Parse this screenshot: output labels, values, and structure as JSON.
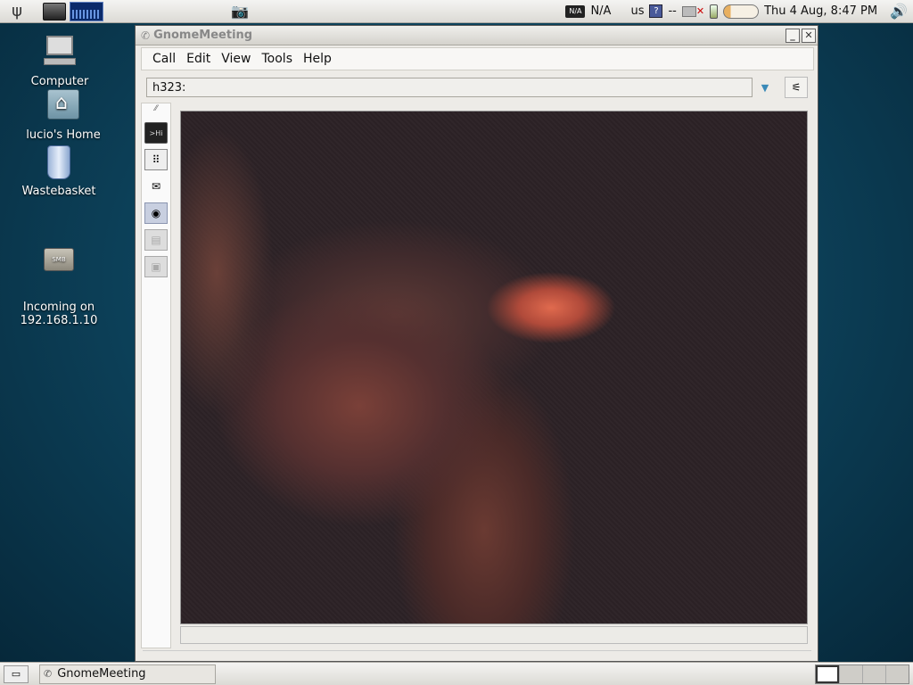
{
  "top_panel": {
    "clock": "Thu  4 Aug,  8:47 PM",
    "network_status": "N/A",
    "keyboard_layout": "us",
    "keyboard_indicator": "?",
    "separator": "--",
    "icons": [
      "gnome-foot-icon",
      "terminal-icon",
      "system-monitor-icon",
      "screenshot-camera-icon",
      "network-badge-icon",
      "network-disconnected-icon",
      "battery-icon",
      "battery-bar-icon",
      "volume-icon"
    ]
  },
  "desktop": {
    "icons": [
      {
        "label": "Computer"
      },
      {
        "label": "lucio's Home"
      },
      {
        "label": "Wastebasket"
      },
      {
        "label": "Incoming on\n192.168.1.10"
      }
    ]
  },
  "window": {
    "title": "GnomeMeeting",
    "menu": [
      "Call",
      "Edit",
      "View",
      "Tools",
      "Help"
    ],
    "url_value": "h323:",
    "tools": [
      "text-chat-icon",
      "dialpad-icon",
      "address-book-icon",
      "camera-icon",
      "audio-settings-icon",
      "video-settings-icon"
    ]
  },
  "bottom_panel": {
    "task_label": "GnomeMeeting",
    "workspaces": 4,
    "active_workspace": 1
  }
}
